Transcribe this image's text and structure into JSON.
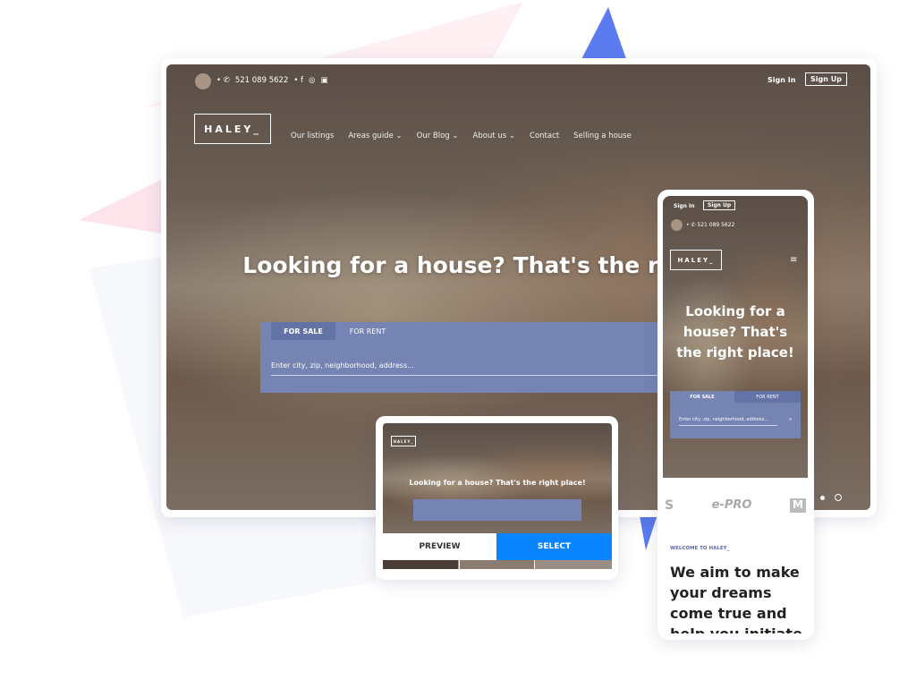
{
  "desktop": {
    "phone": "521 089 5622",
    "sign_in": "Sign In",
    "sign_up": "Sign Up",
    "logo": "HALEY_",
    "nav": [
      "Our listings",
      "Areas guide ⌄",
      "Our Blog ⌄",
      "About us ⌄",
      "Contact",
      "Selling a house"
    ],
    "hero": "Looking for a house? That's the right place!",
    "tabs": [
      "FOR SALE",
      "FOR RENT"
    ],
    "search_placeholder": "Enter city, zip, neighborhood, address..."
  },
  "tablet": {
    "preview": "PREVIEW",
    "select": "SELECT",
    "hero": "Looking for a house? That's the right place!",
    "logo": "HALEY_"
  },
  "mobile": {
    "sign_in": "Sign In",
    "sign_up": "Sign Up",
    "phone": "521 089 5622",
    "logo": "HALEY_",
    "hero": "Looking for a house? That's the right place!",
    "tabs": [
      "FOR SALE",
      "FOR RENT"
    ],
    "search_placeholder": "Enter city, zip, neighborhood, address...",
    "partners": [
      "S",
      "e-PRO",
      "M"
    ],
    "welcome": "WELCOME TO HALEY_",
    "headline": "We aim to make your dreams come true and help you initiate"
  },
  "colors": {
    "accent": "#0a84ff",
    "search": "#7584b3",
    "tab_active": "#6473a6"
  }
}
